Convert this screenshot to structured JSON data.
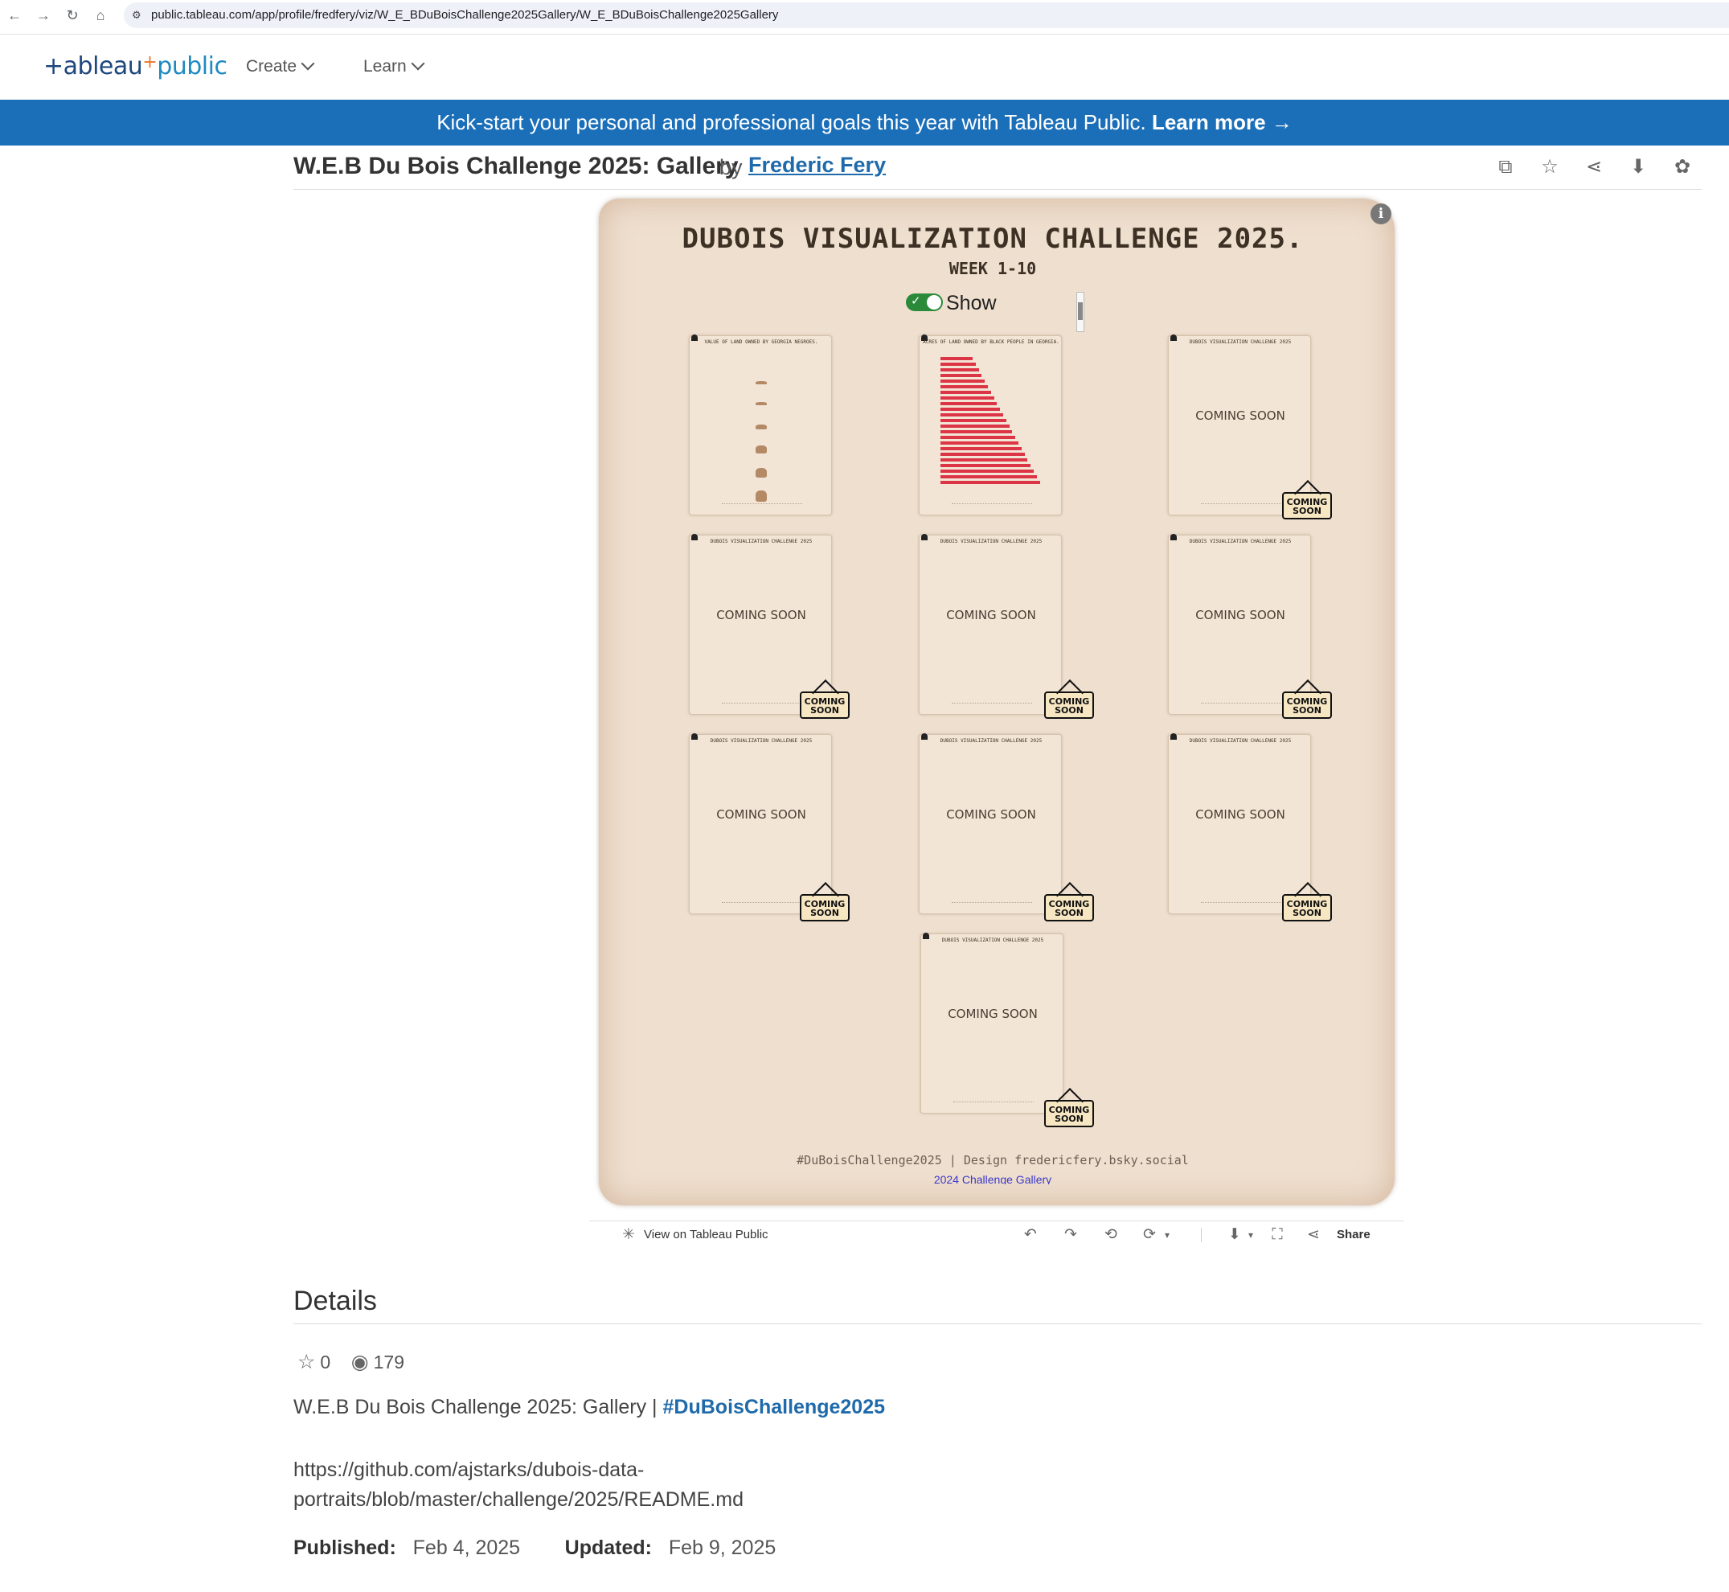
{
  "browser": {
    "url": "public.tableau.com/app/profile/fredfery/viz/W_E_BDuBoisChallenge2025Gallery/W_E_BDuBoisChallenge2025Gallery"
  },
  "header": {
    "logo_main": "+ableau",
    "logo_plus": "+",
    "logo_pub": "public",
    "menu": [
      {
        "label": "Create"
      },
      {
        "label": "Learn"
      }
    ]
  },
  "banner": {
    "text": "Kick-start your personal and professional goals this year with Tableau Public.",
    "link": "Learn more →"
  },
  "viz": {
    "title": "W.E.B Du Bois Challenge 2025: Gallery",
    "by": "by",
    "author": "Frederic Fery",
    "action_icons": [
      "copy-icon",
      "star-icon",
      "share-icon",
      "download-icon",
      "award-icon"
    ]
  },
  "dashboard": {
    "title": "DUBOIS VISUALIZATION CHALLENGE 2025.",
    "subtitle": "WEEK 1-10",
    "toggle_label": "Show",
    "toggle_on": true,
    "card1_title": "VALUE OF LAND OWNED BY GEORGIA NEGROES.",
    "card2_title": "ACRES OF LAND OWNED BY BLACK PEOPLE IN GEORGIA.",
    "placeholder_title": "DUBOIS VISUALIZATION CHALLENGE 2025",
    "coming_soon": "COMING SOON",
    "sign_text_line1": "COMING",
    "sign_text_line2": "SOON",
    "footer": "#DuBoisChallenge2025 | Design fredericfery.bsky.social",
    "footer_link": "2024 Challenge Gallery"
  },
  "toolbar": {
    "view_on": "View on Tableau Public",
    "share": "Share"
  },
  "details": {
    "heading": "Details",
    "favorites": "0",
    "views": "179",
    "description": "W.E.B Du Bois Challenge 2025: Gallery |",
    "hashtag": "#DuBoisChallenge2025",
    "link_line1": "https://github.com/ajstarks/dubois-data-",
    "link_line2": "portraits/blob/master/challenge/2025/README.md",
    "published_label": "Published:",
    "published": "Feb 4, 2025",
    "updated_label": "Updated:",
    "updated": "Feb 9, 2025"
  },
  "colors": {
    "banner": "#1b6fb8",
    "link": "#1f6aaa",
    "paper": "#efdfcf",
    "bar": "#dc3545",
    "toggle": "#2a8a3a"
  }
}
